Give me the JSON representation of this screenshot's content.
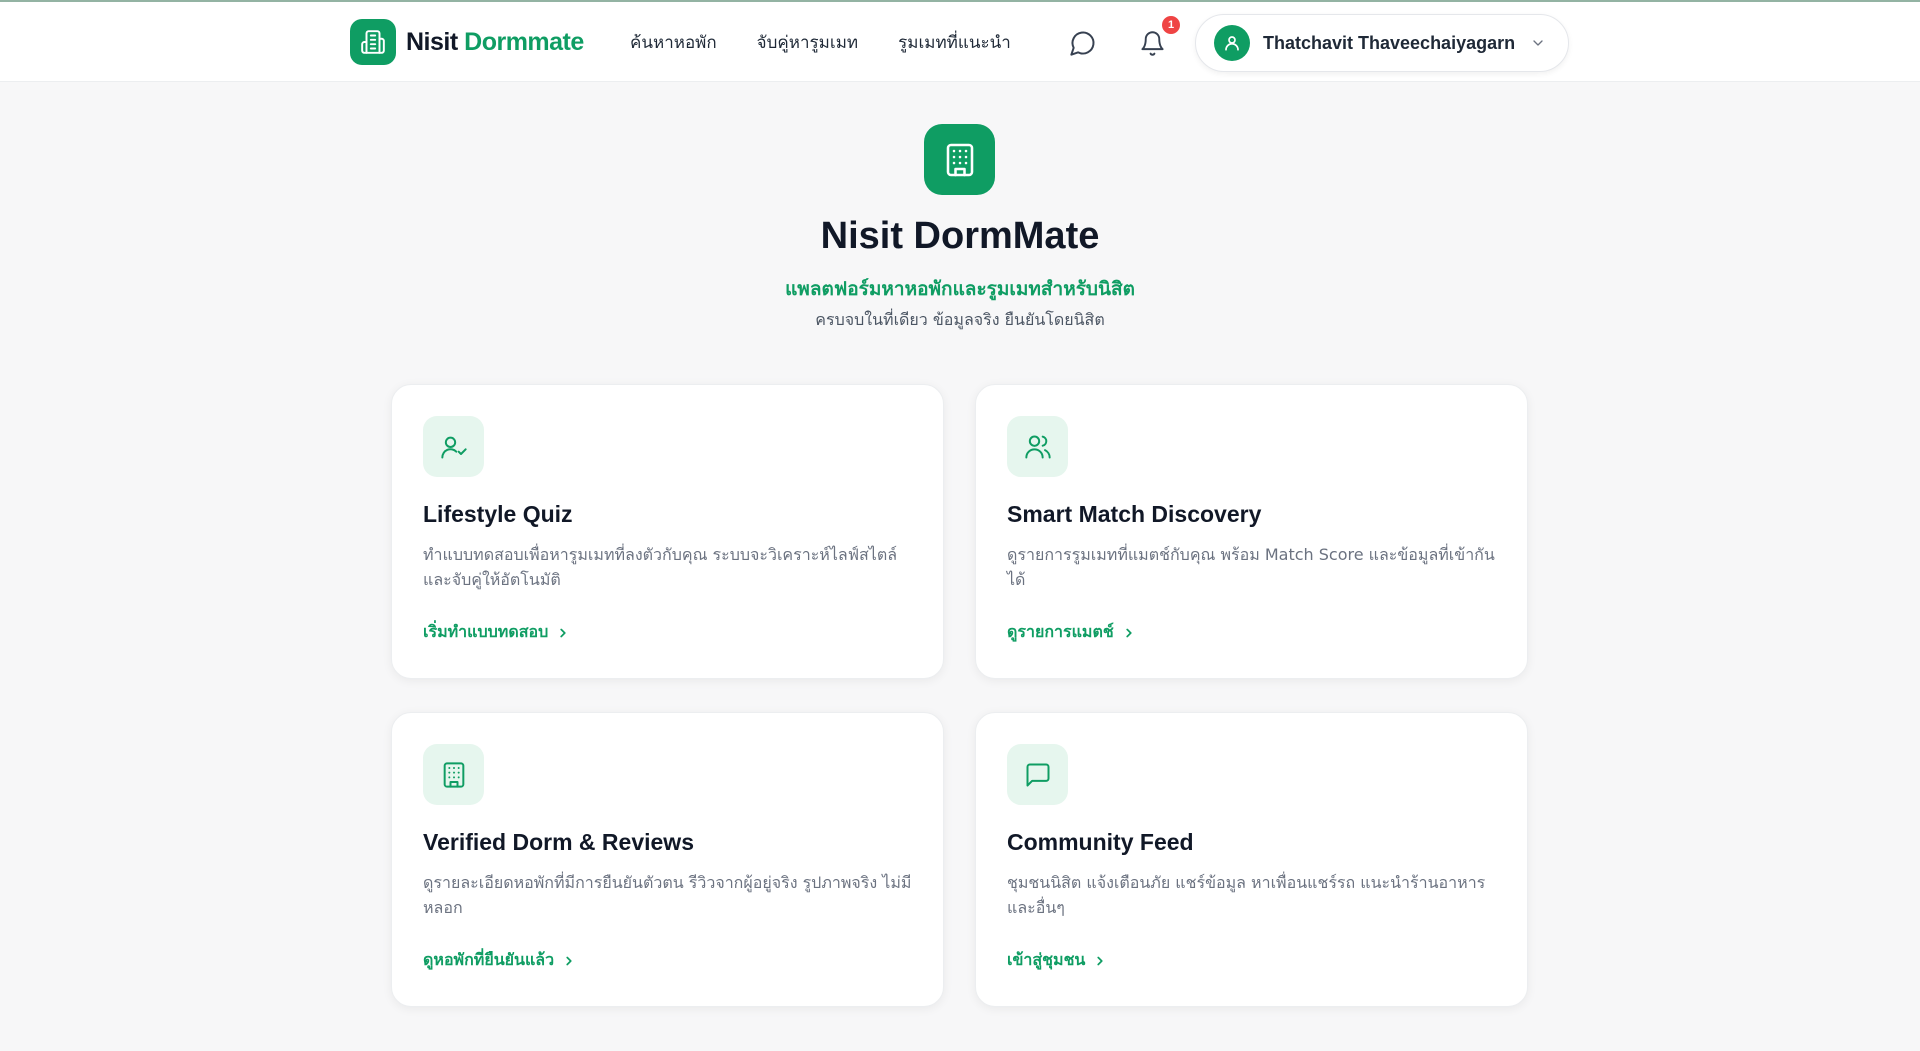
{
  "colors": {
    "brand": "#0f9d63",
    "brand_light": "#e6f6ee",
    "badge": "#ef4444",
    "text": "#111827",
    "muted": "#6b7280"
  },
  "nav": {
    "brand_name_part1": "Nisit",
    "brand_name_part2": "Dormmate",
    "links": [
      "ค้นหาหอพัก",
      "จับคู่หารูมเมท",
      "รูมเมทที่แนะนำ"
    ],
    "notification_count": "1",
    "user_name": "Thatchavit Thaveechaiyagarn",
    "icons": {
      "brand": "building-icon",
      "chat": "message-circle-icon",
      "bell": "bell-icon",
      "avatar": "user-icon",
      "chevron": "chevron-down-icon"
    }
  },
  "hero": {
    "title": "Nisit DormMate",
    "subtitle": "แพลตฟอร์มหาหอพักและรูมเมทสำหรับนิสิต",
    "description": "ครบจบในที่เดียว ข้อมูลจริง ยืนยันโดยนิสิต",
    "icon": "building-icon"
  },
  "cards": [
    {
      "icon": "user-check-icon",
      "title": "Lifestyle Quiz",
      "description": "ทำแบบทดสอบเพื่อหารูมเมทที่ลงตัวกับคุณ ระบบจะวิเคราะห์ไลฟ์สไตล์และจับคู่ให้อัตโนมัติ",
      "link": "เริ่มทำแบบทดสอบ"
    },
    {
      "icon": "users-icon",
      "title": "Smart Match Discovery",
      "description": "ดูรายการรูมเมทที่แมตช์กับคุณ พร้อม Match Score และข้อมูลที่เข้ากันได้",
      "link": "ดูรายการแมตช์"
    },
    {
      "icon": "building-icon",
      "title": "Verified Dorm & Reviews",
      "description": "ดูรายละเอียดหอพักที่มีการยืนยันตัวตน รีวิวจากผู้อยู่จริง รูปภาพจริง ไม่มีหลอก",
      "link": "ดูหอพักที่ยืนยันแล้ว"
    },
    {
      "icon": "message-square-icon",
      "title": "Community Feed",
      "description": "ชุมชนนิสิต แจ้งเตือนภัย แชร์ข้อมูล หาเพื่อนแชร์รถ แนะนำร้านอาหาร และอื่นๆ",
      "link": "เข้าสู่ชุมชน"
    }
  ]
}
